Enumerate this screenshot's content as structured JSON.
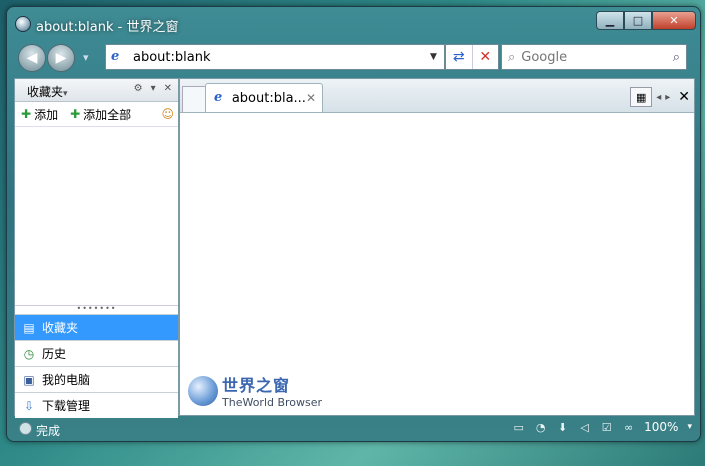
{
  "window": {
    "title": "about:blank - 世界之窗"
  },
  "titlebar": {
    "min_symbol": "▁",
    "max_symbol": "□",
    "close_symbol": "✕"
  },
  "toolbar": {
    "back_symbol": "◀",
    "forward_symbol": "▶",
    "history_dropdown_symbol": "▾",
    "address_value": "about:blank",
    "address_dropdown_symbol": "▼",
    "refresh_symbol": "⇄",
    "stop_symbol": "✕",
    "search_placeholder": "Google",
    "search_go_symbol": "⌕"
  },
  "sidebar": {
    "title": "收藏夹",
    "title_arrow": "▾",
    "controls": [
      "⚙",
      "▾",
      "✕"
    ],
    "add_label": "添加",
    "add_all_label": "添加全部",
    "grip": "•••••••",
    "items": [
      {
        "label": "收藏夹",
        "icon": "bookmark-icon",
        "glyph": "▤",
        "active": true
      },
      {
        "label": "历史",
        "icon": "history-icon",
        "glyph": "◷",
        "active": false
      },
      {
        "label": "我的电脑",
        "icon": "computer-icon",
        "glyph": "▣",
        "active": false
      },
      {
        "label": "下载管理",
        "icon": "download-icon",
        "glyph": "⇩",
        "active": false
      }
    ]
  },
  "tabs": [
    {
      "label": "about:bla...",
      "close_symbol": "✕"
    }
  ],
  "tab_tools": {
    "grid_symbol": "▦",
    "prev_symbol": "◂",
    "next_symbol": "▸",
    "close_symbol": "✕"
  },
  "logo": {
    "cn": "世界之窗",
    "en": "TheWorld Browser"
  },
  "status": {
    "text": "完成",
    "zoom": "100%",
    "zoom_arrow": "▾",
    "icons": [
      {
        "name": "panel-icon",
        "glyph": "▭"
      },
      {
        "name": "speed-icon",
        "glyph": "◔"
      },
      {
        "name": "download-status-icon",
        "glyph": "⬇"
      },
      {
        "name": "mute-icon",
        "glyph": "◁"
      },
      {
        "name": "security-icon",
        "glyph": "☑"
      },
      {
        "name": "zoom-glasses-icon",
        "glyph": "∞"
      }
    ]
  },
  "colors": {
    "accent": "#3399ff",
    "stop": "#d4302a",
    "title_bar": "#2f7380"
  }
}
